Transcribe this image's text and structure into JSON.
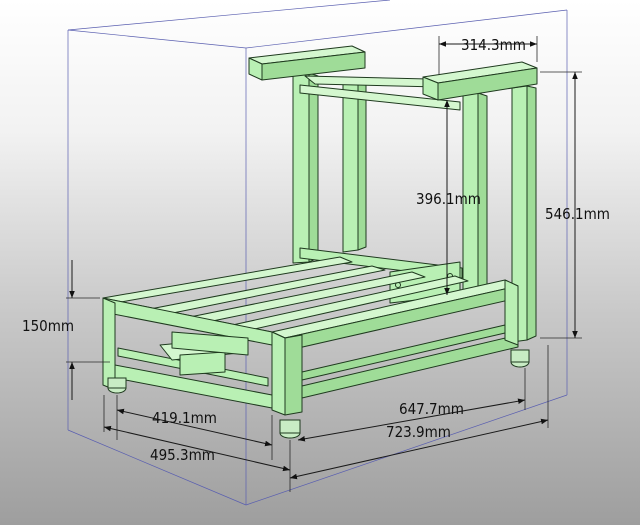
{
  "dimensions": {
    "top_width": "314.3mm",
    "upright_height": "396.1mm",
    "total_height": "546.1mm",
    "base_height": "150mm",
    "inner_width": "419.1mm",
    "outer_width": "495.3mm",
    "inner_length": "647.7mm",
    "outer_length": "723.9mm"
  },
  "colors": {
    "frame": "#b9f0b4",
    "outline": "#1f3a1f",
    "bounding_box": "#5a5fb0"
  }
}
